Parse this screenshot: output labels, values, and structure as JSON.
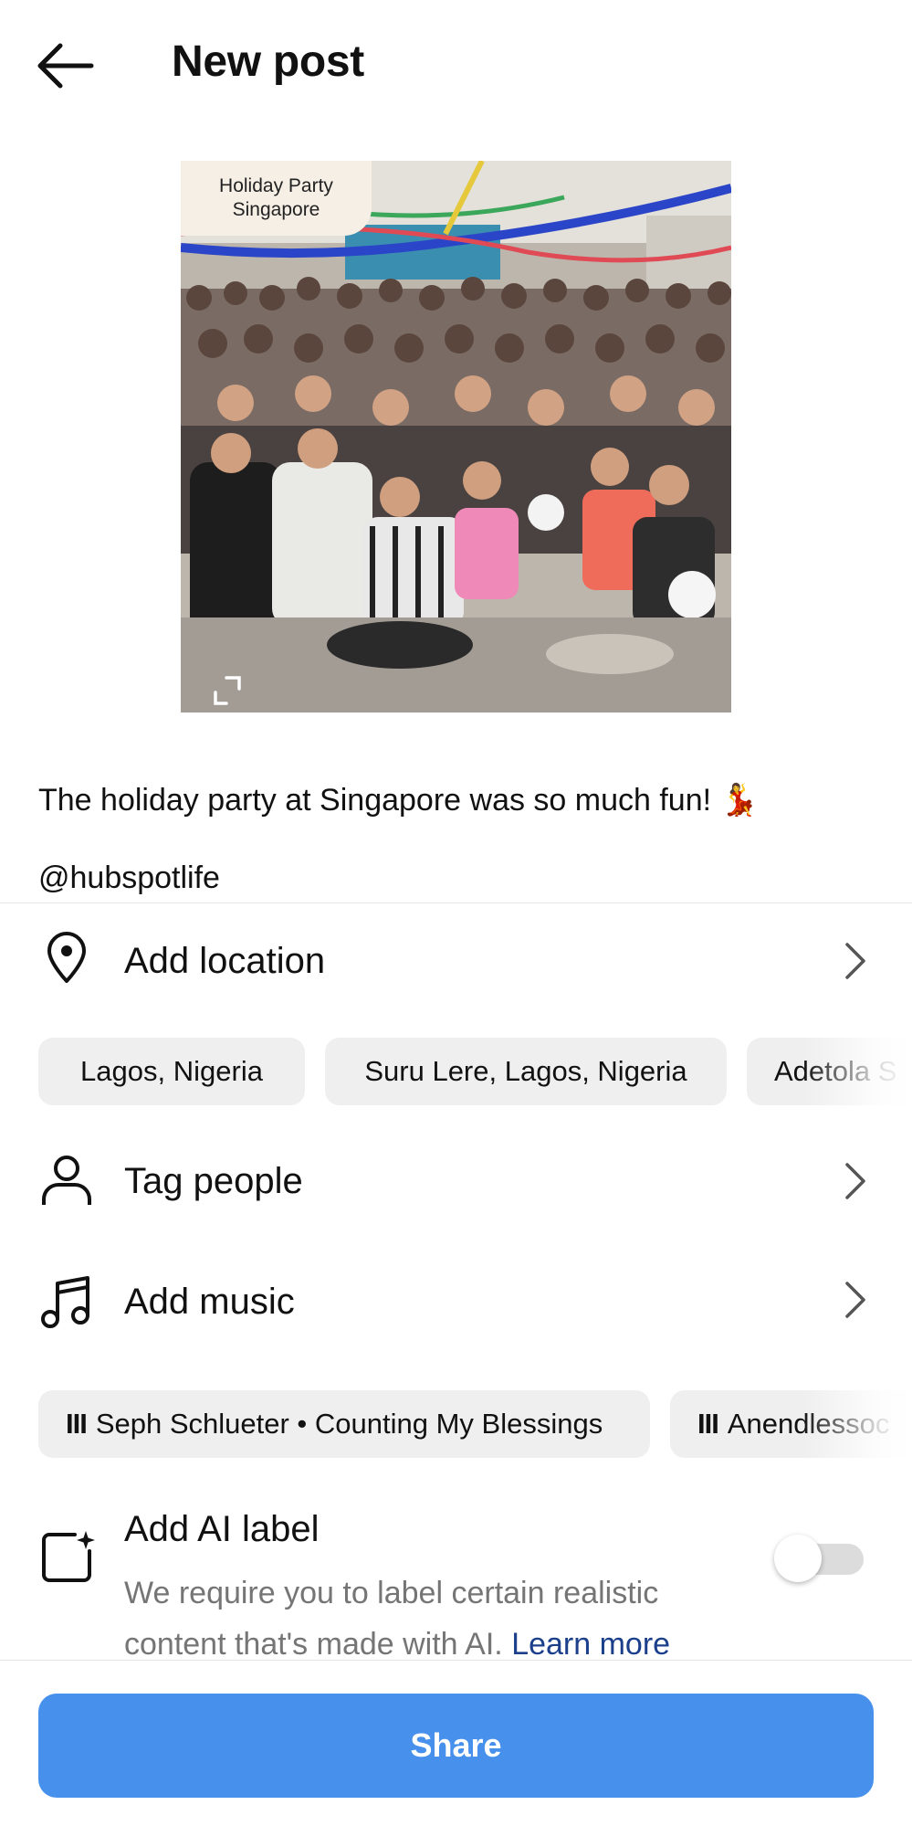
{
  "header": {
    "back_icon": "arrow-left-icon",
    "title": "New post"
  },
  "photo": {
    "badge_line1": "Holiday Party",
    "badge_line2": "Singapore",
    "expand_icon": "expand-corners-icon"
  },
  "caption": {
    "line1": "The holiday party at Singapore was so much fun! 💃",
    "line2": "@hubspotlife"
  },
  "location": {
    "icon": "map-pin-icon",
    "label": "Add location",
    "chevron_icon": "chevron-right-icon",
    "suggestions": [
      "Lagos, Nigeria",
      "Suru Lere, Lagos, Nigeria",
      "Adetola S"
    ]
  },
  "tag_people": {
    "icon": "person-icon",
    "label": "Tag people",
    "chevron_icon": "chevron-right-icon"
  },
  "music": {
    "icon": "music-note-icon",
    "label": "Add music",
    "chevron_icon": "chevron-right-icon",
    "bars_glyph": "III",
    "suggestions": [
      "Seph Schlueter • Counting My Blessings",
      "Anendlessoc"
    ]
  },
  "ai_label": {
    "icon": "ai-sparkle-square-icon",
    "title": "Add AI label",
    "description": "We require you to label certain realistic content that's made with AI.",
    "learn_more": "Learn more",
    "toggle_on": false
  },
  "share": {
    "label": "Share",
    "color": "#4791ec"
  }
}
